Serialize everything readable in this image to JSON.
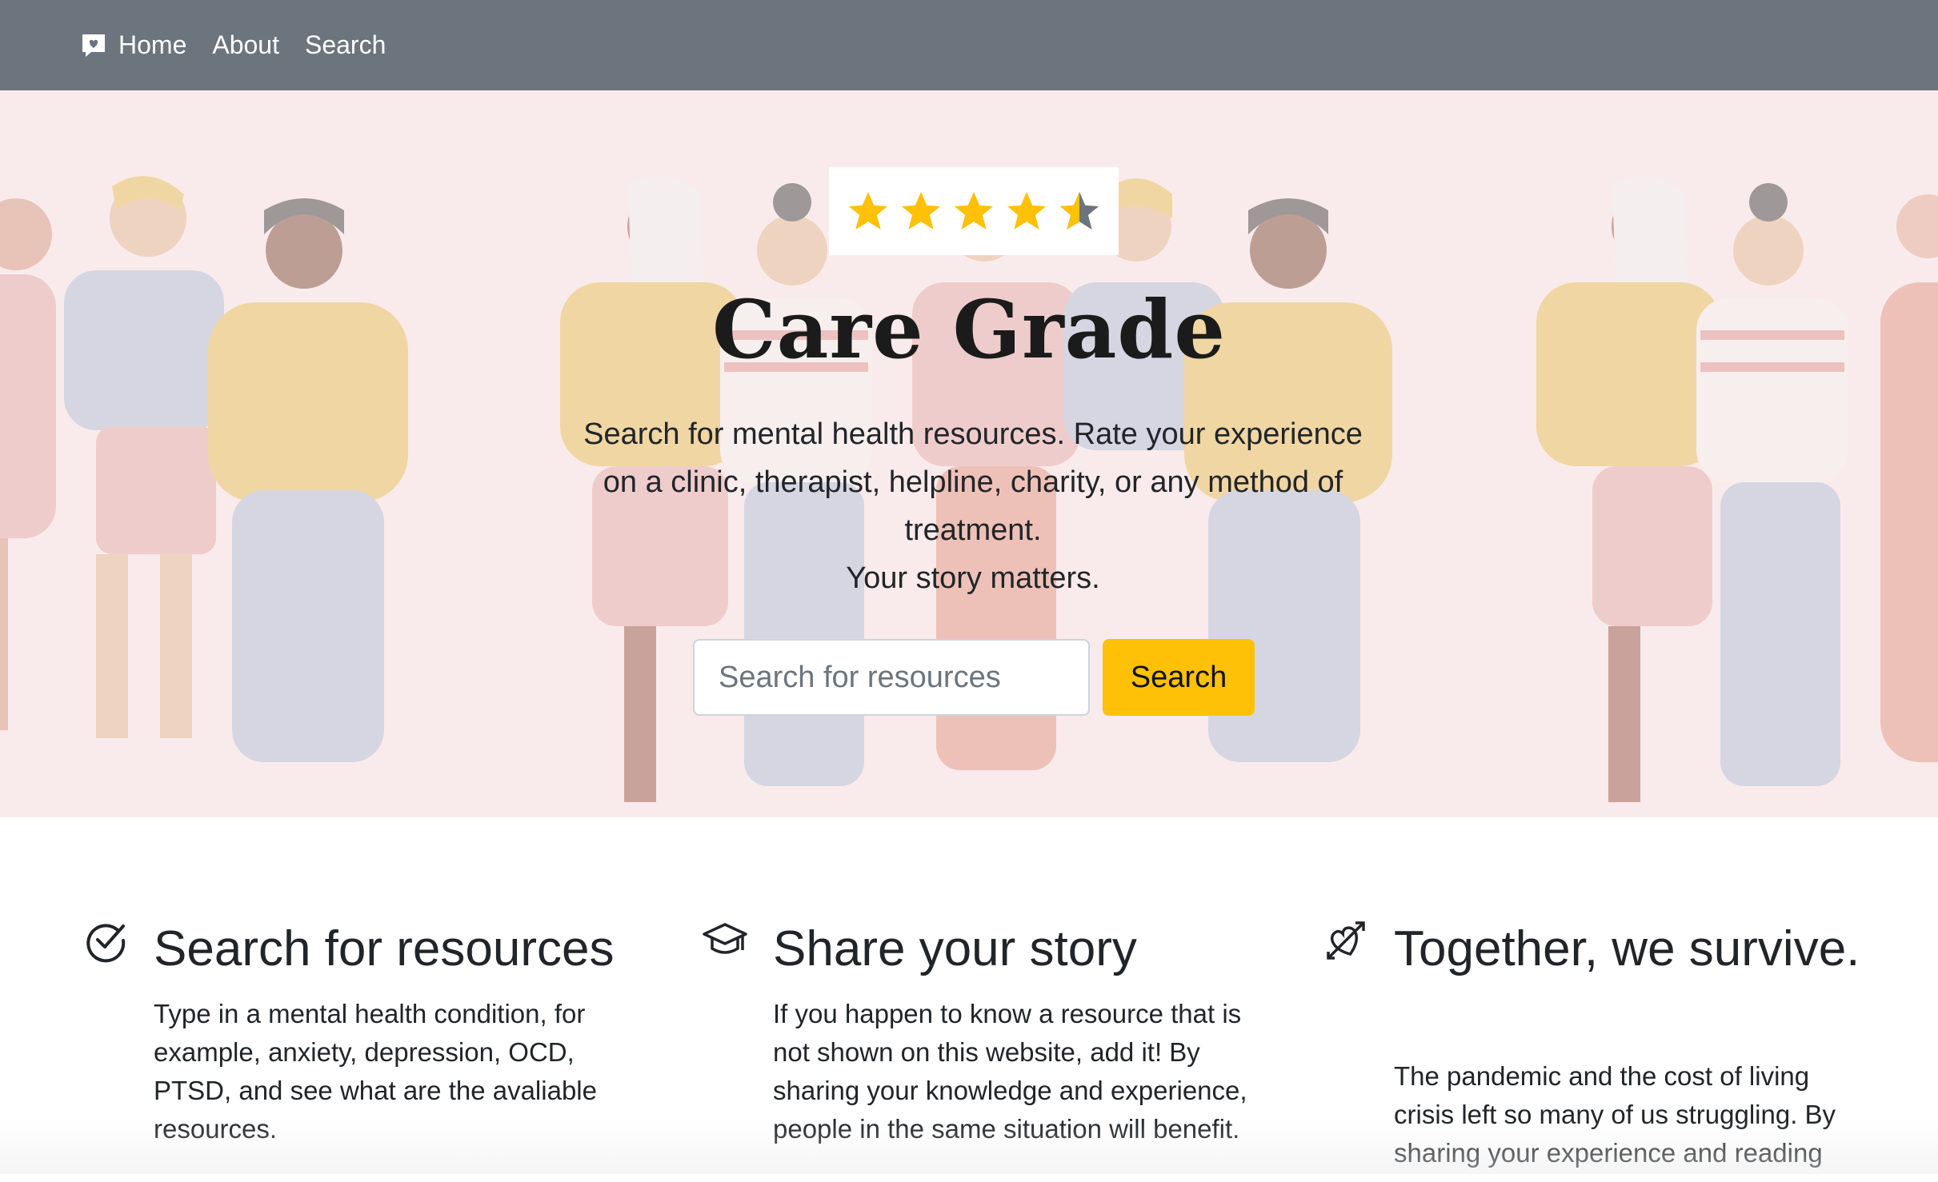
{
  "navbar": {
    "brand_icon": "chat-heart-icon",
    "links": [
      "Home",
      "About",
      "Search"
    ]
  },
  "hero": {
    "rating": {
      "value": 4.5,
      "max": 5,
      "star_color": "#ffc107",
      "empty_color": "#6c757d"
    },
    "title": "Care Grade",
    "description_line1": "Search for mental health resources. Rate your experience on a clinic, therapist, helpline, charity, or any method of treatment.",
    "description_line2": "Your story matters.",
    "search_placeholder": "Search for resources",
    "search_button": "Search"
  },
  "features": [
    {
      "icon": "check-circle-icon",
      "title": "Search for resources",
      "text": "Type in a mental health condition, for example, anxiety, depression, OCD, PTSD, and see what are the avaliable resources."
    },
    {
      "icon": "mortarboard-icon",
      "title": "Share your story",
      "text": "If you happen to know a resource that is not shown on this website, add it! By sharing your knowledge and experience, people in the same situation will benefit."
    },
    {
      "icon": "arrow-through-heart-icon",
      "title": "Together, we survive.",
      "text": "The pandemic and the cost of living crisis left so many of us struggling. By sharing your experience and reading"
    }
  ],
  "colors": {
    "navbar": "#6c757d",
    "hero_bg": "#f9ebeb",
    "accent": "#ffc107"
  }
}
